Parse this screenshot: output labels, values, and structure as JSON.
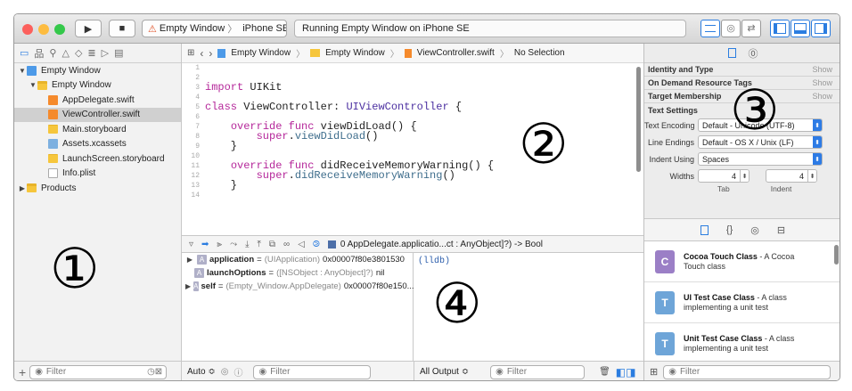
{
  "toolbar": {
    "scheme_target": "Empty Window",
    "scheme_device": "iPhone SE",
    "status": "Running Empty Window on iPhone SE",
    "colors": {
      "close": "#fc605c",
      "minimize": "#fdbc40",
      "zoom": "#34c84a",
      "accent": "#2b7de0"
    }
  },
  "navigator": {
    "items": [
      {
        "label": "Empty Window",
        "depth": 0,
        "icon": "project-icon",
        "open": true
      },
      {
        "label": "Empty Window",
        "depth": 1,
        "icon": "folder-icon",
        "open": true
      },
      {
        "label": "AppDelegate.swift",
        "depth": 2,
        "icon": "swift-file-icon"
      },
      {
        "label": "ViewController.swift",
        "depth": 2,
        "icon": "swift-file-icon",
        "selected": true
      },
      {
        "label": "Main.storyboard",
        "depth": 2,
        "icon": "storyboard-file-icon"
      },
      {
        "label": "Assets.xcassets",
        "depth": 2,
        "icon": "assets-folder-icon"
      },
      {
        "label": "LaunchScreen.storyboard",
        "depth": 2,
        "icon": "storyboard-file-icon"
      },
      {
        "label": "Info.plist",
        "depth": 2,
        "icon": "plist-file-icon"
      },
      {
        "label": "Products",
        "depth": 0,
        "icon": "folder-icon",
        "open": false
      }
    ],
    "filter_placeholder": "Filter",
    "region_marker": "①"
  },
  "editor": {
    "breadcrumb": [
      "Empty Window",
      "Empty Window",
      "ViewController.swift",
      "No Selection"
    ],
    "line_numbers": [
      "1",
      "2",
      "3",
      "4",
      "5",
      "6",
      "7",
      "8",
      "9",
      "10",
      "11",
      "12",
      "13",
      "14"
    ],
    "region_marker": "②"
  },
  "debug": {
    "frame": "0 AppDelegate.applicatio...ct : AnyObject]?) -> Bool",
    "variables": [
      {
        "name": "application",
        "type": "(UIApplication)",
        "value": "0x00007f80e3801530",
        "expand": true
      },
      {
        "name": "launchOptions",
        "type": "([NSObject : AnyObject]?)",
        "value": "nil",
        "expand": false
      },
      {
        "name": "self",
        "type": "(Empty_Window.AppDelegate)",
        "value": "0x00007f80e150...",
        "expand": true
      }
    ],
    "console_prompt": "(lldb)",
    "vars_scope": "Auto ≎",
    "output_scope": "All Output ≎",
    "filter_placeholder": "Filter",
    "region_marker": "④"
  },
  "inspector": {
    "sections": [
      {
        "title": "Identity and Type",
        "action": "Show"
      },
      {
        "title": "On Demand Resource Tags",
        "action": "Show"
      },
      {
        "title": "Target Membership",
        "action": "Show"
      }
    ],
    "text_settings_title": "Text Settings",
    "encoding_label": "Text Encoding",
    "encoding_value": "Default - Unicode (UTF-8)",
    "endings_label": "Line Endings",
    "endings_value": "Default - OS X / Unix (LF)",
    "indent_label": "Indent Using",
    "indent_value": "Spaces",
    "widths_label": "Widths",
    "tab_width": "4",
    "indent_width": "4",
    "tab_caption": "Tab",
    "indent_caption": "Indent",
    "region_marker": "③"
  },
  "library": {
    "items": [
      {
        "letter": "C",
        "title": "Cocoa Touch Class",
        "desc": " - A Cocoa Touch class",
        "color": "#9b7fc6"
      },
      {
        "letter": "T",
        "title": "UI Test Case Class",
        "desc": " - A class implementing a unit test",
        "color": "#6ea5d8"
      },
      {
        "letter": "T",
        "title": "Unit Test Case Class",
        "desc": " - A class implementing a unit test",
        "color": "#6ea5d8"
      }
    ],
    "filter_placeholder": "Filter"
  }
}
